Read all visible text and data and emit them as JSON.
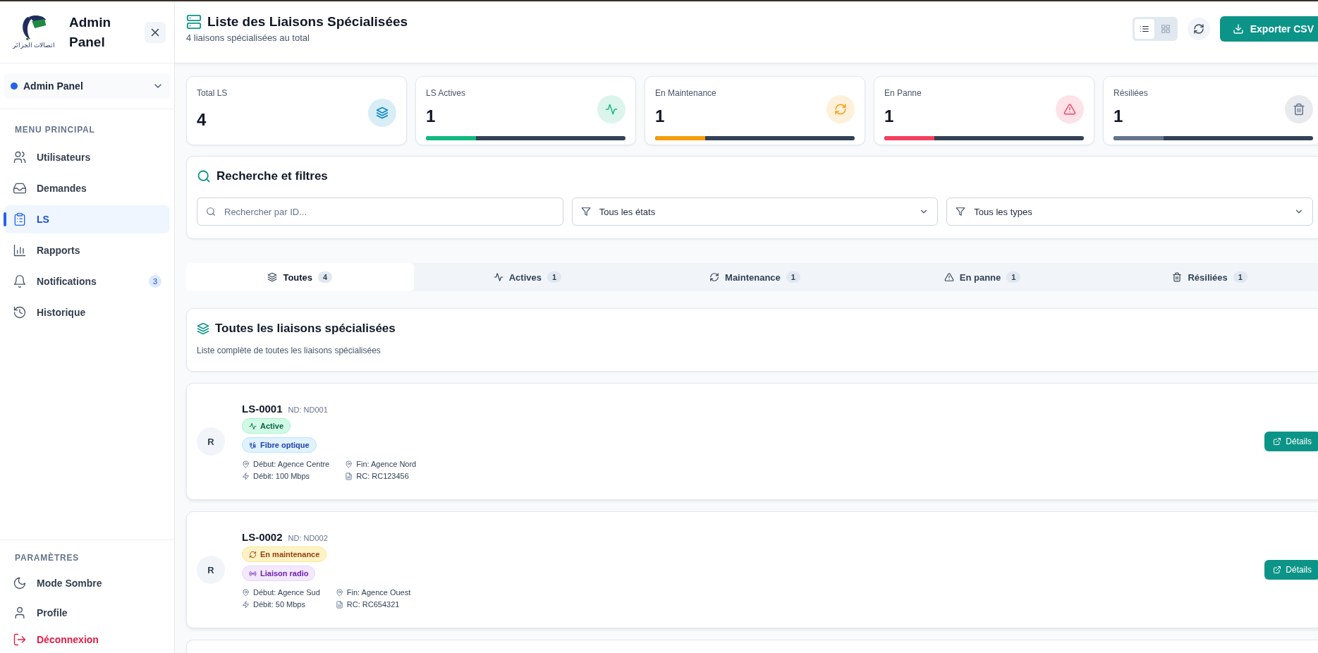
{
  "sidebar": {
    "logo_text": "اتصالات الجزائر",
    "title": "Admin Panel",
    "workspace": "Admin Panel",
    "menu_label": "MENU PRINCIPAL",
    "items": [
      {
        "label": "Utilisateurs",
        "selected": false
      },
      {
        "label": "Demandes",
        "selected": false
      },
      {
        "label": "LS",
        "selected": true
      },
      {
        "label": "Rapports",
        "selected": false
      },
      {
        "label": "Notifications",
        "selected": false,
        "badge": "3"
      },
      {
        "label": "Historique",
        "selected": false
      }
    ],
    "settings_label": "PARAMÈTRES",
    "settings": [
      {
        "label": "Mode Sombre",
        "kind": "theme"
      },
      {
        "label": "Profile",
        "kind": "profile"
      },
      {
        "label": "Déconnexion",
        "kind": "logout"
      }
    ]
  },
  "header": {
    "title": "Liste des Liaisons Spécialisées",
    "subtitle": "4 liaisons spécialisées au total",
    "views": [
      {
        "kind": "list",
        "selected": true
      },
      {
        "kind": "grid",
        "selected": false
      }
    ],
    "export_button": "Exporter CSV"
  },
  "stats": [
    {
      "label": "Total LS",
      "value": "4",
      "color": "#0284c7"
    },
    {
      "label": "LS Actives",
      "value": "1",
      "color": "#10b981",
      "level": 0.25
    },
    {
      "label": "En Maintenance",
      "value": "1",
      "color": "#f59e0b",
      "level": 0.25
    },
    {
      "label": "En Panne",
      "value": "1",
      "color": "#f43f5e",
      "level": 0.25
    },
    {
      "label": "Résiliées",
      "value": "1",
      "color": "#64748b",
      "level": 0.25
    }
  ],
  "filters": {
    "title": "Recherche et filtres",
    "search_placeholder": "Rechercher par ID...",
    "selects": [
      "Tous les états",
      "Tous les types"
    ]
  },
  "tabs": [
    {
      "label": "Toutes",
      "count": "4",
      "selected": true
    },
    {
      "label": "Actives",
      "count": "1",
      "selected": false
    },
    {
      "label": "Maintenance",
      "count": "1",
      "selected": false
    },
    {
      "label": "En panne",
      "count": "1",
      "selected": false
    },
    {
      "label": "Résiliées",
      "count": "1",
      "selected": false
    }
  ],
  "list": {
    "title": "Toutes les liaisons spécialisées",
    "subtitle": "Liste complète de toutes les liaisons spécialisées"
  },
  "rows": [
    {
      "avatar": "R",
      "id": "LS-0001",
      "nd": "ND: ND001",
      "status": {
        "label": "Active",
        "kind": "active"
      },
      "type": {
        "label": "Fibre optique",
        "kind": "fibre"
      },
      "details": [
        {
          "kind": "start",
          "text": "Début: Agence Centre"
        },
        {
          "kind": "end",
          "text": "Fin: Agence Nord"
        },
        {
          "kind": "rate",
          "text": "Débit: 100 Mbps"
        },
        {
          "kind": "rc",
          "text": "RC: RC123456"
        }
      ],
      "button": "Détails"
    },
    {
      "avatar": "R",
      "id": "LS-0002",
      "nd": "ND: ND002",
      "status": {
        "label": "En maintenance",
        "kind": "maintenance"
      },
      "type": {
        "label": "Liaison radio",
        "kind": "radio"
      },
      "details": [
        {
          "kind": "start",
          "text": "Début: Agence Sud"
        },
        {
          "kind": "end",
          "text": "Fin: Agence Ouest"
        },
        {
          "kind": "rate",
          "text": "Débit: 50 Mbps"
        },
        {
          "kind": "rc",
          "text": "RC: RC654321"
        }
      ],
      "button": "Détails"
    }
  ]
}
